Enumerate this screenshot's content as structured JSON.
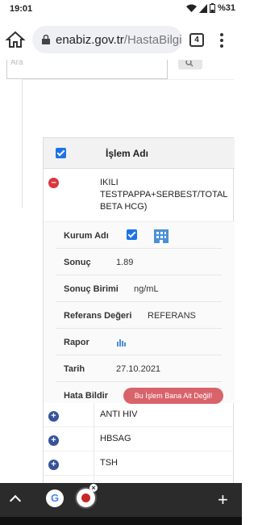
{
  "status": {
    "time": "19:01",
    "battery": "%31"
  },
  "browser": {
    "url_host": "enabiz.gov.tr",
    "url_path": "/HastaBilgil",
    "tab_count": "4"
  },
  "search": {
    "placeholder": "Ara"
  },
  "table": {
    "header_label": "İşlem Adı",
    "expanded_row": {
      "name": "IKILI TESTPAPPA+SERBEST/TOTAL BETA HCG)",
      "details": {
        "kurum_label": "Kurum Adı",
        "sonuc_label": "Sonuç",
        "sonuc_value": "1.89",
        "birim_label": "Sonuç Birimi",
        "birim_value": "ng/mL",
        "referans_label": "Referans Değeri",
        "referans_value": "REFERANS",
        "rapor_label": "Rapor",
        "tarih_label": "Tarih",
        "tarih_value": "27.10.2021",
        "hata_label": "Hata Bildir",
        "hata_button": "Bu İşlem Bana Ait Değil!"
      }
    },
    "rows": [
      {
        "name": "ANTI HIV"
      },
      {
        "name": "HBSAG"
      },
      {
        "name": "TSH"
      }
    ]
  },
  "colors": {
    "accent": "#1a73e8",
    "minus": "#d9363e",
    "plus": "#35539a",
    "error": "#d9636b"
  }
}
